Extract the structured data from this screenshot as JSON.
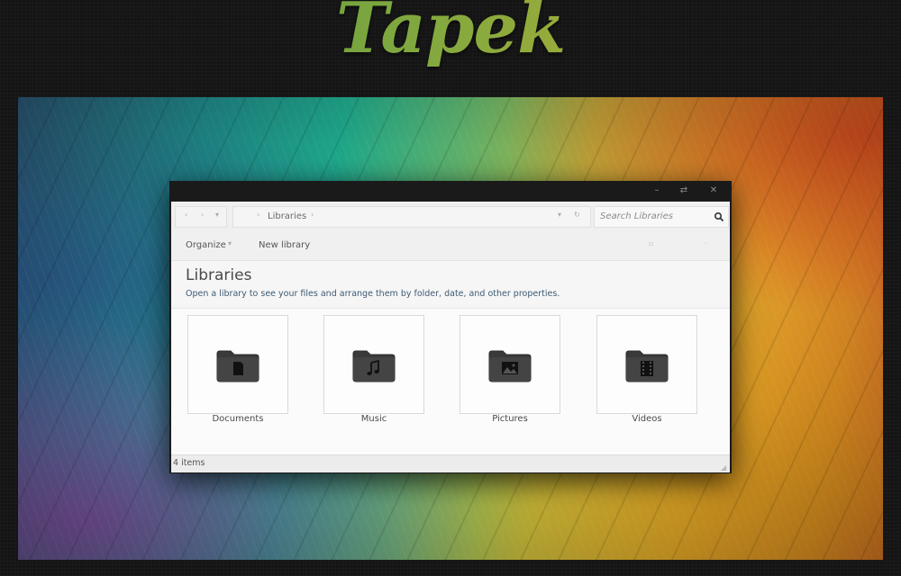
{
  "logo": {
    "text": "Tapek"
  },
  "window": {
    "controls": {
      "minimize": "–",
      "maximize": "⇄",
      "close": "✕"
    }
  },
  "nav": {
    "back": "‹",
    "forward": "›",
    "history": "▾",
    "breadcrumb": [
      "Libraries"
    ],
    "search_placeholder": "Search Libraries"
  },
  "toolbar": {
    "organize_label": "Organize",
    "organize_arrow": "▾",
    "new_library_label": "New library"
  },
  "header": {
    "title": "Libraries",
    "subtitle": "Open a library to see your files and arrange them by folder, date, and other properties."
  },
  "libraries": [
    {
      "label": "Documents",
      "icon": "document-folder-icon"
    },
    {
      "label": "Music",
      "icon": "music-folder-icon"
    },
    {
      "label": "Pictures",
      "icon": "pictures-folder-icon"
    },
    {
      "label": "Videos",
      "icon": "videos-folder-icon"
    }
  ],
  "status": {
    "item_count": "4 items"
  },
  "colors": {
    "accent_title_text": "#3d5a74",
    "window_frame": "#1b1b1b",
    "folder": "#3a3a3a"
  }
}
